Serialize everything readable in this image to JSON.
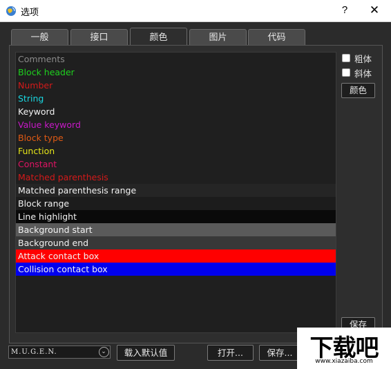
{
  "window": {
    "title": "选项",
    "help": "?",
    "close": "✕"
  },
  "tabs": [
    {
      "label": "一般",
      "active": false
    },
    {
      "label": "接口",
      "active": false
    },
    {
      "label": "颜色",
      "active": true
    },
    {
      "label": "图片",
      "active": false
    },
    {
      "label": "代码",
      "active": false
    }
  ],
  "color_list": [
    {
      "label": "Comments",
      "color": "#8a8a8a",
      "bg": "#1f1f1f"
    },
    {
      "label": "Block header",
      "color": "#1ed11e",
      "bg": "#1f1f1f"
    },
    {
      "label": "Number",
      "color": "#d41a1a",
      "bg": "#1f1f1f"
    },
    {
      "label": "String",
      "color": "#19d6e0",
      "bg": "#1f1f1f"
    },
    {
      "label": "Keyword",
      "color": "#f2f2f2",
      "bg": "#1f1f1f"
    },
    {
      "label": "Value keyword",
      "color": "#c819c8",
      "bg": "#1f1f1f"
    },
    {
      "label": "Block type",
      "color": "#e05a14",
      "bg": "#1f1f1f"
    },
    {
      "label": "Function",
      "color": "#e6e619",
      "bg": "#1f1f1f"
    },
    {
      "label": "Constant",
      "color": "#e01464",
      "bg": "#1f1f1f"
    },
    {
      "label": "Matched parenthesis",
      "color": "#d41a1a",
      "bg": "#1f1f1f"
    },
    {
      "label": "Matched parenthesis range",
      "color": "#f2f2f2",
      "bg": "#252525"
    },
    {
      "label": "Block range",
      "color": "#f2f2f2",
      "bg": "#1c1c1c"
    },
    {
      "label": "Line highlight",
      "color": "#f2f2f2",
      "bg": "#0a0a0a"
    },
    {
      "label": "Background start",
      "color": "#f2f2f2",
      "bg": "#5a5a5a"
    },
    {
      "label": "Background end",
      "color": "#f2f2f2",
      "bg": "#383838"
    },
    {
      "label": "Attack contact box",
      "color": "#f2f2f2",
      "bg": "#ff0000"
    },
    {
      "label": "Collision contact box",
      "color": "#f2f2f2",
      "bg": "#0000ee"
    }
  ],
  "options": {
    "bold_label": "粗体",
    "italic_label": "斜体",
    "color_button": "颜色",
    "save_button": "保存"
  },
  "footer": {
    "preset_value": "M.U.G.E.N.",
    "load_default_button": "载入默认值",
    "open_button": "打开...",
    "save_as_button": "保存..."
  },
  "watermark": {
    "brand": "下载吧",
    "url": "www.xiazaiba.com"
  }
}
